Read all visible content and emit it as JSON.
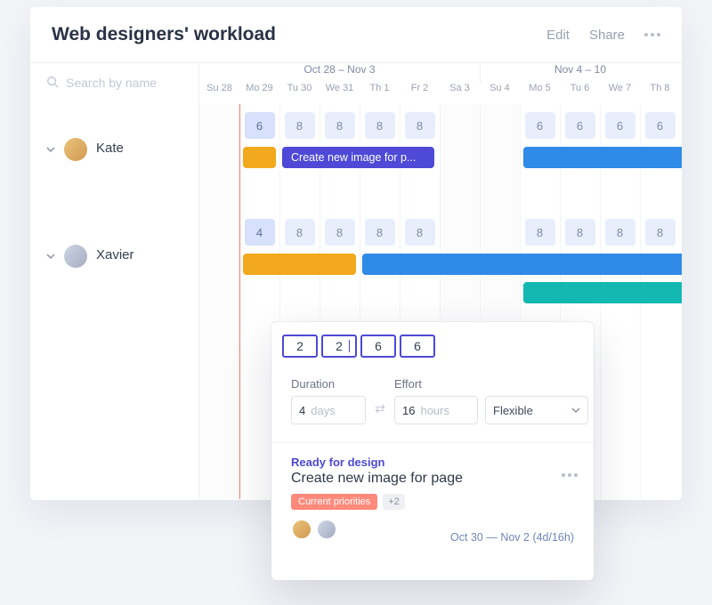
{
  "header": {
    "title": "Web designers' workload",
    "edit": "Edit",
    "share": "Share"
  },
  "search": {
    "placeholder": "Search by name"
  },
  "weeks": {
    "a": "Oct 28 – Nov 3",
    "b": "Nov 4 – 10"
  },
  "days": [
    "Su 28",
    "Mo 29",
    "Tu 30",
    "We 31",
    "Th 1",
    "Fr 2",
    "Sa 3",
    "Su 4",
    "Mo 5",
    "Tu 6",
    "We 7",
    "Th 8"
  ],
  "people": [
    {
      "name": "Kate"
    },
    {
      "name": "Xavier"
    }
  ],
  "capacity": {
    "kate": [
      "",
      "6",
      "8",
      "8",
      "8",
      "8",
      "",
      "",
      "6",
      "6",
      "6",
      "6"
    ],
    "xavier": [
      "",
      "4",
      "8",
      "8",
      "8",
      "8",
      "",
      "",
      "8",
      "8",
      "8",
      "8"
    ]
  },
  "tasklabel": "Create new image for p...",
  "popover": {
    "edit": [
      "2",
      "2",
      "6",
      "6"
    ],
    "duration_label": "Duration",
    "duration_val": "4",
    "duration_unit": "days",
    "effort_label": "Effort",
    "effort_val": "16",
    "effort_unit": "hours",
    "mode": "Flexible",
    "status": "Ready for design",
    "task": "Create new image for page",
    "tag": "Current priorities",
    "tagmore": "+2",
    "dates": "Oct 30 — Nov 2 (4d/16h)"
  }
}
